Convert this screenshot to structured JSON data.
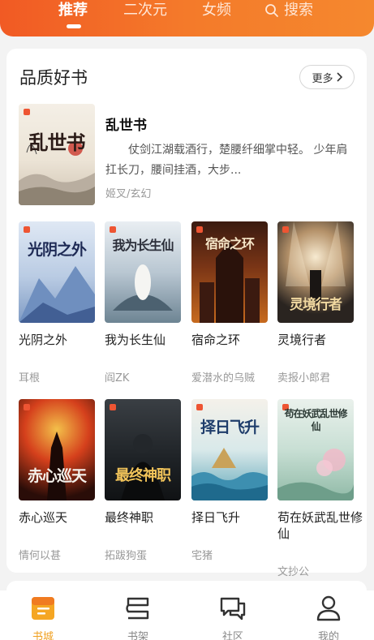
{
  "top_tabs": [
    {
      "label": "推荐",
      "active": true
    },
    {
      "label": "二次元",
      "active": false
    },
    {
      "label": "女频",
      "active": false
    }
  ],
  "search": {
    "label": "搜索",
    "icon": "search-icon"
  },
  "section": {
    "title": "品质好书",
    "more_label": "更多"
  },
  "featured": {
    "title": "乱世书",
    "description": "仗剑江湖载酒行，楚腰纤细掌中轻。 少年肩扛长刀，腰间挂酒，大步...",
    "meta": "姬叉/玄幻",
    "cover_text": "乱世书"
  },
  "books": [
    {
      "title": "光阴之外",
      "author": "耳根",
      "cover_text": "光阴之外"
    },
    {
      "title": "我为长生仙",
      "author": "阎ZK",
      "cover_text": "我为长生仙"
    },
    {
      "title": "宿命之环",
      "author": "爱潜水的乌贼",
      "cover_text": "宿命之环"
    },
    {
      "title": "灵境行者",
      "author": "卖报小郎君",
      "cover_text": "灵境行者"
    },
    {
      "title": "赤心巡天",
      "author": "情何以甚",
      "cover_text": "赤心巡天"
    },
    {
      "title": "最终神职",
      "author": "拓跋狗蛋",
      "cover_text": "最终神职"
    },
    {
      "title": "择日飞升",
      "author": "宅猪",
      "cover_text": "择日飞升"
    },
    {
      "title": "苟在妖武乱世修仙",
      "author": "文抄公",
      "cover_text": "苟在妖武乱世修仙"
    }
  ],
  "bottom_nav": [
    {
      "label": "书城",
      "icon": "bookstore-icon",
      "active": true
    },
    {
      "label": "书架",
      "icon": "bookshelf-icon",
      "active": false
    },
    {
      "label": "社区",
      "icon": "community-icon",
      "active": false
    },
    {
      "label": "我的",
      "icon": "profile-icon",
      "active": false
    }
  ],
  "colors": {
    "accent": "#f47a2a",
    "nav_active": "#f0a020"
  }
}
